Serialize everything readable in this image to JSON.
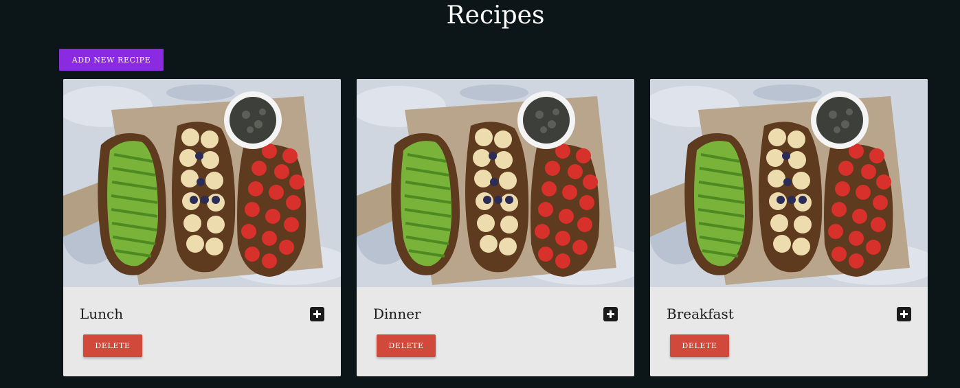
{
  "page": {
    "title": "Recipes",
    "background_color": "#0c1518"
  },
  "toolbar": {
    "add_label": "ADD NEW RECIPE",
    "add_color": "#8a2be2"
  },
  "recipes": [
    {
      "name": "Lunch",
      "delete_label": "DELETE",
      "image": "avocado-banana-tomato-toast-photo",
      "add_icon": "plus-square-icon"
    },
    {
      "name": "Dinner",
      "delete_label": "DELETE",
      "image": "avocado-banana-tomato-toast-photo",
      "add_icon": "plus-square-icon"
    },
    {
      "name": "Breakfast",
      "delete_label": "DELETE",
      "image": "avocado-banana-tomato-toast-photo",
      "add_icon": "plus-square-icon"
    }
  ],
  "colors": {
    "card_background": "#e8e8e8",
    "delete_button": "#d0493a",
    "plus_icon_background": "#1b1b1b"
  }
}
